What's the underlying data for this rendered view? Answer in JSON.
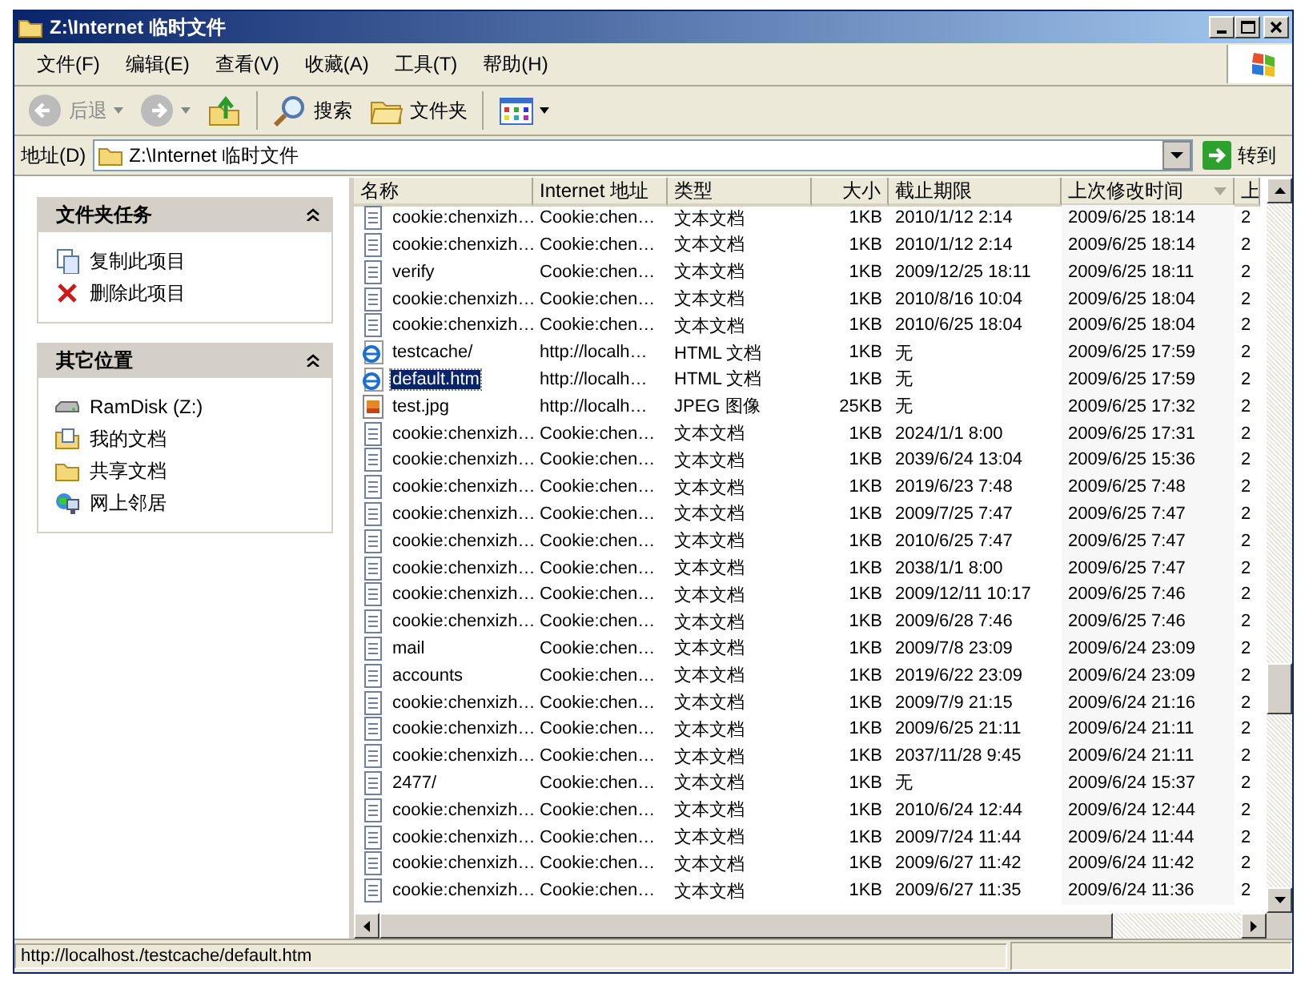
{
  "window": {
    "title": "Z:\\Internet 临时文件"
  },
  "menu": [
    "文件(F)",
    "编辑(E)",
    "查看(V)",
    "收藏(A)",
    "工具(T)",
    "帮助(H)"
  ],
  "toolbar": [
    {
      "kind": "back",
      "label": "后退",
      "disabled": true
    },
    {
      "kind": "forward",
      "disabled": true
    },
    {
      "kind": "up",
      "disabled": false
    },
    {
      "kind": "search",
      "label": "搜索",
      "disabled": false
    },
    {
      "kind": "folders",
      "label": "文件夹",
      "disabled": false
    },
    {
      "kind": "views",
      "disabled": false
    }
  ],
  "address": {
    "label": "地址(D)",
    "value": "Z:\\Internet 临时文件",
    "go": "转到"
  },
  "sidebar": [
    {
      "title": "文件夹任务",
      "expanded": true,
      "items": [
        {
          "kind": "copy",
          "label": "复制此项目"
        },
        {
          "kind": "delete",
          "label": "删除此项目"
        }
      ]
    },
    {
      "title": "其它位置",
      "expanded": true,
      "items": [
        {
          "kind": "drive",
          "label": "RamDisk (Z:)"
        },
        {
          "kind": "docs",
          "label": "我的文档"
        },
        {
          "kind": "folder",
          "label": "共享文档"
        },
        {
          "kind": "network",
          "label": "网上邻居"
        }
      ]
    }
  ],
  "table": {
    "columns": [
      {
        "label": "名称",
        "sorted": false
      },
      {
        "label": "Internet 地址",
        "sorted": false
      },
      {
        "label": "类型",
        "sorted": false
      },
      {
        "label": "大小",
        "sorted": false
      },
      {
        "label": "截止期限",
        "sorted": false
      },
      {
        "label": "上次修改时间",
        "sorted": true
      },
      {
        "label": "上",
        "sorted": false
      }
    ],
    "rows": [
      {
        "kind": "text",
        "selected": false,
        "cells": [
          "cookie:chenxizh…",
          "Cookie:chen…",
          "文本文档",
          "1KB",
          "2010/1/12 2:14",
          "2009/6/25 18:14",
          "2"
        ]
      },
      {
        "kind": "text",
        "selected": false,
        "cells": [
          "cookie:chenxizh…",
          "Cookie:chen…",
          "文本文档",
          "1KB",
          "2010/1/12 2:14",
          "2009/6/25 18:14",
          "2"
        ]
      },
      {
        "kind": "text",
        "selected": false,
        "cells": [
          "verify",
          "Cookie:chen…",
          "文本文档",
          "1KB",
          "2009/12/25 18:11",
          "2009/6/25 18:11",
          "2"
        ]
      },
      {
        "kind": "text",
        "selected": false,
        "cells": [
          "cookie:chenxizh…",
          "Cookie:chen…",
          "文本文档",
          "1KB",
          "2010/8/16 10:04",
          "2009/6/25 18:04",
          "2"
        ]
      },
      {
        "kind": "text",
        "selected": false,
        "cells": [
          "cookie:chenxizh…",
          "Cookie:chen…",
          "文本文档",
          "1KB",
          "2010/6/25 18:04",
          "2009/6/25 18:04",
          "2"
        ]
      },
      {
        "kind": "html",
        "selected": false,
        "cells": [
          "testcache/",
          "http://localh…",
          "HTML 文档",
          "1KB",
          "无",
          "2009/6/25 17:59",
          "2"
        ]
      },
      {
        "kind": "html",
        "selected": true,
        "cells": [
          "default.htm",
          "http://localh…",
          "HTML 文档",
          "1KB",
          "无",
          "2009/6/25 17:59",
          "2"
        ]
      },
      {
        "kind": "image",
        "selected": false,
        "cells": [
          "test.jpg",
          "http://localh…",
          "JPEG 图像",
          "25KB",
          "无",
          "2009/6/25 17:32",
          "2"
        ]
      },
      {
        "kind": "text",
        "selected": false,
        "cells": [
          "cookie:chenxizh…",
          "Cookie:chen…",
          "文本文档",
          "1KB",
          "2024/1/1 8:00",
          "2009/6/25 17:31",
          "2"
        ]
      },
      {
        "kind": "text",
        "selected": false,
        "cells": [
          "cookie:chenxizh…",
          "Cookie:chen…",
          "文本文档",
          "1KB",
          "2039/6/24 13:04",
          "2009/6/25 15:36",
          "2"
        ]
      },
      {
        "kind": "text",
        "selected": false,
        "cells": [
          "cookie:chenxizh…",
          "Cookie:chen…",
          "文本文档",
          "1KB",
          "2019/6/23 7:48",
          "2009/6/25 7:48",
          "2"
        ]
      },
      {
        "kind": "text",
        "selected": false,
        "cells": [
          "cookie:chenxizh…",
          "Cookie:chen…",
          "文本文档",
          "1KB",
          "2009/7/25 7:47",
          "2009/6/25 7:47",
          "2"
        ]
      },
      {
        "kind": "text",
        "selected": false,
        "cells": [
          "cookie:chenxizh…",
          "Cookie:chen…",
          "文本文档",
          "1KB",
          "2010/6/25 7:47",
          "2009/6/25 7:47",
          "2"
        ]
      },
      {
        "kind": "text",
        "selected": false,
        "cells": [
          "cookie:chenxizh…",
          "Cookie:chen…",
          "文本文档",
          "1KB",
          "2038/1/1 8:00",
          "2009/6/25 7:47",
          "2"
        ]
      },
      {
        "kind": "text",
        "selected": false,
        "cells": [
          "cookie:chenxizh…",
          "Cookie:chen…",
          "文本文档",
          "1KB",
          "2009/12/11 10:17",
          "2009/6/25 7:46",
          "2"
        ]
      },
      {
        "kind": "text",
        "selected": false,
        "cells": [
          "cookie:chenxizh…",
          "Cookie:chen…",
          "文本文档",
          "1KB",
          "2009/6/28 7:46",
          "2009/6/25 7:46",
          "2"
        ]
      },
      {
        "kind": "text",
        "selected": false,
        "cells": [
          "mail",
          "Cookie:chen…",
          "文本文档",
          "1KB",
          "2009/7/8 23:09",
          "2009/6/24 23:09",
          "2"
        ]
      },
      {
        "kind": "text",
        "selected": false,
        "cells": [
          "accounts",
          "Cookie:chen…",
          "文本文档",
          "1KB",
          "2019/6/22 23:09",
          "2009/6/24 23:09",
          "2"
        ]
      },
      {
        "kind": "text",
        "selected": false,
        "cells": [
          "cookie:chenxizh…",
          "Cookie:chen…",
          "文本文档",
          "1KB",
          "2009/7/9 21:15",
          "2009/6/24 21:16",
          "2"
        ]
      },
      {
        "kind": "text",
        "selected": false,
        "cells": [
          "cookie:chenxizh…",
          "Cookie:chen…",
          "文本文档",
          "1KB",
          "2009/6/25 21:11",
          "2009/6/24 21:11",
          "2"
        ]
      },
      {
        "kind": "text",
        "selected": false,
        "cells": [
          "cookie:chenxizh…",
          "Cookie:chen…",
          "文本文档",
          "1KB",
          "2037/11/28 9:45",
          "2009/6/24 21:11",
          "2"
        ]
      },
      {
        "kind": "text",
        "selected": false,
        "cells": [
          "2477/",
          "Cookie:chen…",
          "文本文档",
          "1KB",
          "无",
          "2009/6/24 15:37",
          "2"
        ]
      },
      {
        "kind": "text",
        "selected": false,
        "cells": [
          "cookie:chenxizh…",
          "Cookie:chen…",
          "文本文档",
          "1KB",
          "2010/6/24 12:44",
          "2009/6/24 12:44",
          "2"
        ]
      },
      {
        "kind": "text",
        "selected": false,
        "cells": [
          "cookie:chenxizh…",
          "Cookie:chen…",
          "文本文档",
          "1KB",
          "2009/7/24 11:44",
          "2009/6/24 11:44",
          "2"
        ]
      },
      {
        "kind": "text",
        "selected": false,
        "cells": [
          "cookie:chenxizh…",
          "Cookie:chen…",
          "文本文档",
          "1KB",
          "2009/6/27 11:42",
          "2009/6/24 11:42",
          "2"
        ]
      },
      {
        "kind": "text",
        "selected": false,
        "cells": [
          "cookie:chenxizh…",
          "Cookie:chen…",
          "文本文档",
          "1KB",
          "2009/6/27 11:35",
          "2009/6/24 11:36",
          "2"
        ]
      }
    ]
  },
  "status_bar": "http://localhost./testcache/default.htm"
}
